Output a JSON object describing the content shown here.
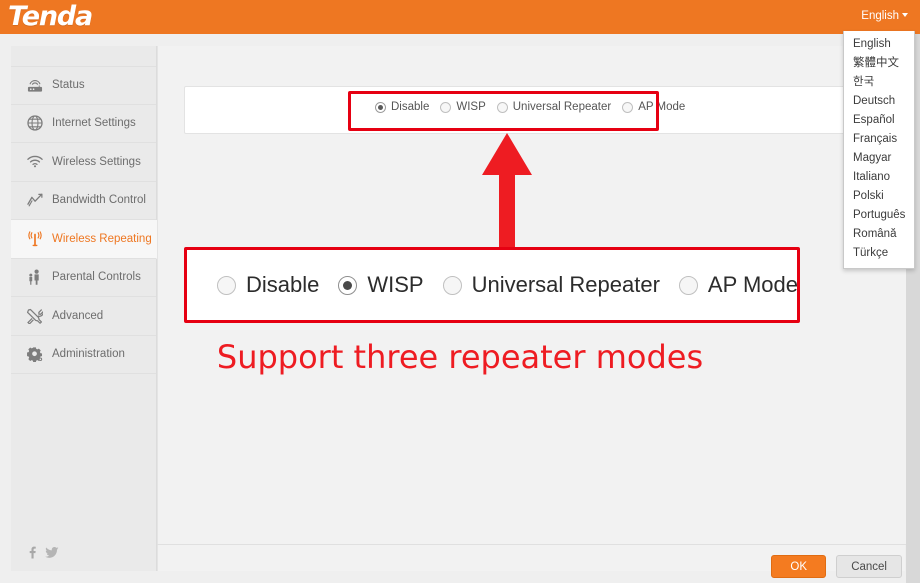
{
  "header": {
    "brand": "Tenda",
    "brand_color": "#ee7722",
    "language_selected": "English"
  },
  "language_menu": {
    "items": [
      {
        "label": "English"
      },
      {
        "label": "繁體中文"
      },
      {
        "label": "한국"
      },
      {
        "label": "Deutsch"
      },
      {
        "label": "Español"
      },
      {
        "label": "Français"
      },
      {
        "label": "Magyar"
      },
      {
        "label": "Italiano"
      },
      {
        "label": "Polski"
      },
      {
        "label": "Português"
      },
      {
        "label": "Română"
      },
      {
        "label": "Türkçe"
      }
    ]
  },
  "sidebar": {
    "active_color": "#ee7722",
    "items": [
      {
        "label": "Status",
        "icon": "router-icon",
        "active": false
      },
      {
        "label": "Internet Settings",
        "icon": "globe-icon",
        "active": false
      },
      {
        "label": "Wireless Settings",
        "icon": "wifi-icon",
        "active": false
      },
      {
        "label": "Bandwidth Control",
        "icon": "chart-line-icon",
        "active": false
      },
      {
        "label": "Wireless Repeating",
        "icon": "antenna-icon",
        "active": true
      },
      {
        "label": "Parental Controls",
        "icon": "parent-child-icon",
        "active": false
      },
      {
        "label": "Advanced",
        "icon": "tools-icon",
        "active": false
      },
      {
        "label": "Administration",
        "icon": "gear-icon",
        "active": false
      }
    ],
    "social": [
      {
        "name": "facebook-icon"
      },
      {
        "name": "twitter-icon"
      }
    ]
  },
  "settings_panel": {
    "modes": [
      {
        "label": "Disable",
        "selected": true
      },
      {
        "label": "WISP",
        "selected": false
      },
      {
        "label": "Universal Repeater",
        "selected": false
      },
      {
        "label": "AP Mode",
        "selected": false
      }
    ]
  },
  "callout": {
    "modes": [
      {
        "label": "Disable",
        "selected": false
      },
      {
        "label": "WISP",
        "selected": true
      },
      {
        "label": "Universal Repeater",
        "selected": false
      },
      {
        "label": "AP Mode",
        "selected": false
      }
    ]
  },
  "annotation": {
    "text": "Support three repeater modes",
    "color": "#ee1c22"
  },
  "footer": {
    "ok_label": "OK",
    "cancel_label": "Cancel",
    "ok_color": "#f47b20"
  }
}
